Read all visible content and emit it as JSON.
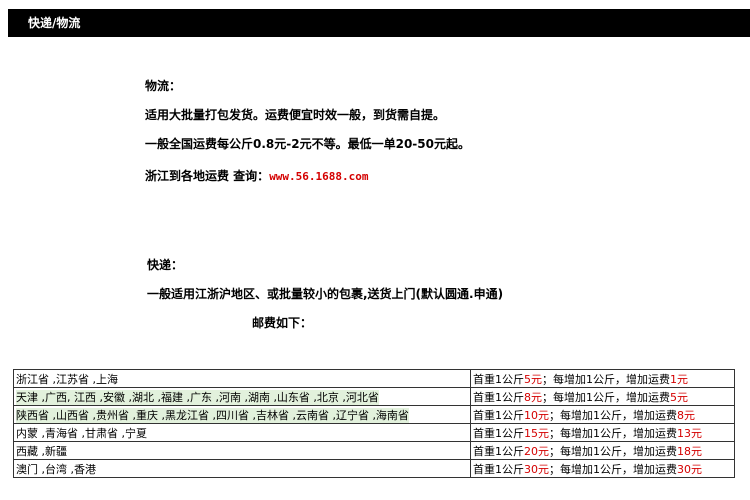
{
  "header": {
    "title": "快递/物流"
  },
  "logistics": {
    "heading": "物流：",
    "line1": "适用大批量打包发货。运费便宜时效一般，到货需自提。",
    "line2": "一般全国运费每公斤0.8元-2元不等。最低一单20-50元起。",
    "query_prefix": "浙江到各地运费 查询：",
    "query_link": "www.56.1688.com"
  },
  "express": {
    "heading": "快递：",
    "line1": "一般适用江浙沪地区、或批量较小的包裹,送货上门(默认圆通.申通)",
    "rates_heading": "邮费如下："
  },
  "rate_table": {
    "rows": [
      {
        "region": "浙江省 ,江苏省 ,上海",
        "highlight": false,
        "first": "首重1公斤",
        "first_price": "5元",
        "sep": "；每增加1公斤，增加运费",
        "add_price": "1元"
      },
      {
        "region": "天津 ,广西, 江西 ,安徽 ,湖北 ,福建 ,广东 ,河南 ,湖南 ,山东省 ,北京 ,河北省",
        "highlight": true,
        "first": "首重1公斤",
        "first_price": "8元",
        "sep": "；每增加1公斤，增加运费",
        "add_price": "5元"
      },
      {
        "region": "陕西省 ,山西省 ,贵州省 ,重庆 ,黑龙江省 ,四川省 ,吉林省 ,云南省 ,辽宁省 ,海南省",
        "highlight": true,
        "first": "首重1公斤",
        "first_price": "10元",
        "sep": "；每增加1公斤，增加运费",
        "add_price": "8元"
      },
      {
        "region": "内蒙 ,青海省 ,甘肃省 ,宁夏",
        "highlight": false,
        "first": "首重1公斤",
        "first_price": "15元",
        "sep": "；每增加1公斤，增加运费",
        "add_price": "13元"
      },
      {
        "region": "西藏 ,新疆",
        "highlight": false,
        "first": "首重1公斤",
        "first_price": "20元",
        "sep": "；每增加1公斤，增加运费",
        "add_price": "18元"
      },
      {
        "region": "澳门 ,台湾 ,香港",
        "highlight": false,
        "first": "首重1公斤",
        "first_price": "30元",
        "sep": "；每增加1公斤，增加运费",
        "add_price": "30元"
      }
    ]
  }
}
